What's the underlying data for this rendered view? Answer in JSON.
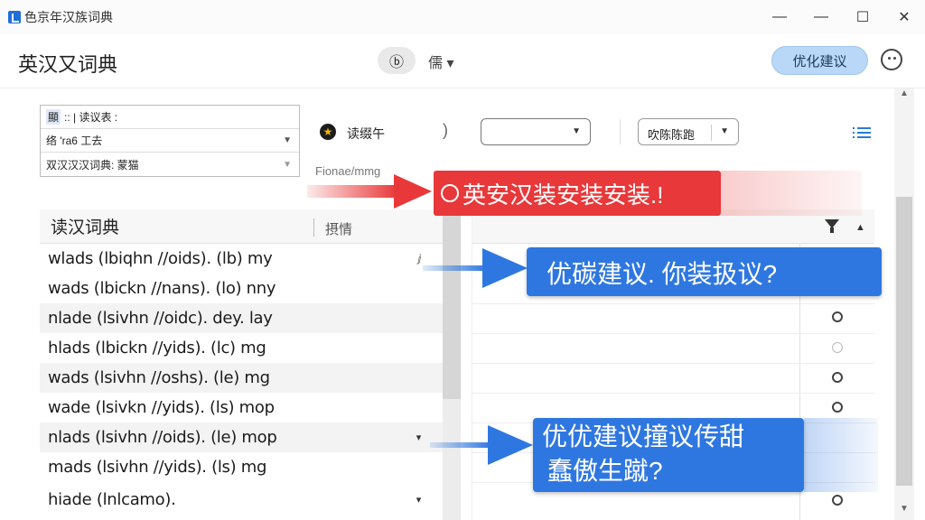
{
  "window": {
    "title": "色京年汉族词典",
    "controls": {
      "minimize": "—",
      "restore": "—",
      "maximize": "☐",
      "close": "✕"
    }
  },
  "header": {
    "app_name": "英汉又词典",
    "toggle_glyph": "ⓑ",
    "language_menu": "儒 ▾",
    "suggest_button": "优化建议"
  },
  "filters": {
    "row1_prefix": "顯",
    "row1_text": ":: | 读议表 :",
    "row2_text": "络 'ra6  工去",
    "row3_text": "双汉汉汉词典: 蒙猫"
  },
  "toolbar": {
    "speaker_label": "读缀午",
    "paren": ")",
    "filter_dropdown": "吹陈陈跑",
    "faded_text": "Fionae/mmg"
  },
  "callouts": {
    "red": "英安汉装安装安装.!",
    "blue1": "优碳建议. 你装扱议?",
    "blue2_line1": "优优建议撞议传甜",
    "blue2_line2": "蠢傲生蹴?"
  },
  "word_list": {
    "header_title": "读汉词典",
    "header_col": "摂情",
    "rows": [
      "wlads (lbiqhn //oids). (lb) my",
      "wads (lbickn //nans). (lo) nny",
      "nlade (lsivhn //oidc). dey. lay",
      "hlads (lbickn //yids). (lc) mg",
      "wads (lsivhn //oshs). (le) mg",
      "wade (lsivkn //yids). (ls) mop",
      "nlads (lsivhn //oids). (le) mop",
      "mads (lsivhn //yids). (ls) mg",
      "hiade (lnlcamo)."
    ],
    "row_marks": [
      "ⅉ",
      "",
      "",
      "",
      "",
      "",
      "▾",
      "",
      "▾"
    ]
  },
  "detail": {
    "sort_glyph": "▲"
  }
}
